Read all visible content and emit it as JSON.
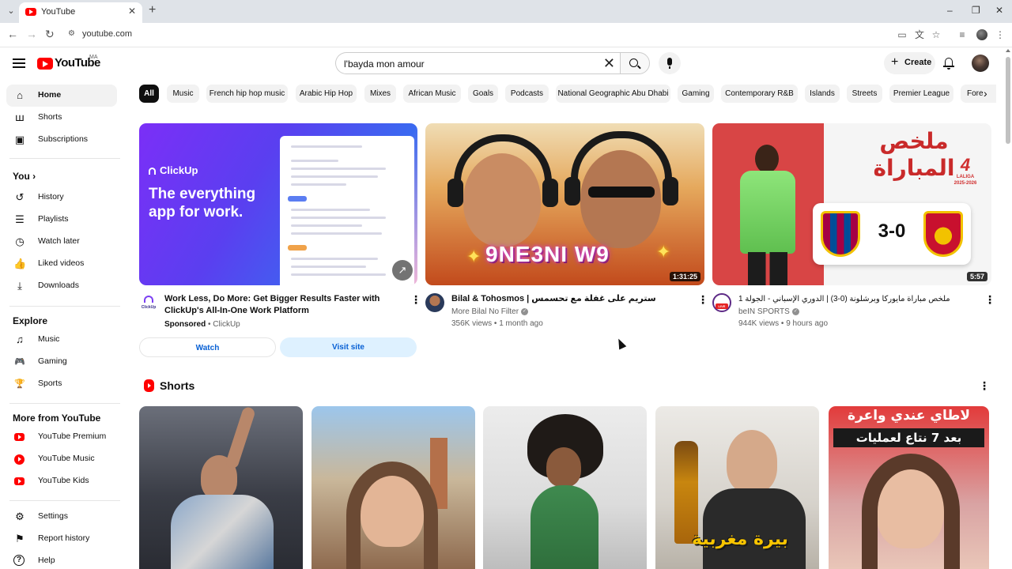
{
  "browser": {
    "tab_title": "YouTube",
    "url": "youtube.com",
    "new_tab": "+",
    "close": "✕"
  },
  "masthead": {
    "logo_text": "YouTube",
    "country_code": "MA",
    "search_value": "l'bayda mon amour",
    "create_label": "Create"
  },
  "sidebar": {
    "main": [
      {
        "label": "Home",
        "icon": "home-icon",
        "glyph": "⌂"
      },
      {
        "label": "Shorts",
        "icon": "shorts-icon",
        "glyph": "ꟺ"
      },
      {
        "label": "Subscriptions",
        "icon": "subscriptions-icon",
        "glyph": "▣"
      }
    ],
    "you_heading": "You",
    "you": [
      {
        "label": "History",
        "icon": "history-icon",
        "glyph": "↺"
      },
      {
        "label": "Playlists",
        "icon": "playlists-icon",
        "glyph": "☰"
      },
      {
        "label": "Watch later",
        "icon": "clock-icon",
        "glyph": "◷"
      },
      {
        "label": "Liked videos",
        "icon": "thumbs-up-icon",
        "glyph": "👍"
      },
      {
        "label": "Downloads",
        "icon": "download-icon",
        "glyph": "⤓"
      }
    ],
    "explore_heading": "Explore",
    "explore": [
      {
        "label": "Music",
        "icon": "music-icon",
        "glyph": "♫"
      },
      {
        "label": "Gaming",
        "icon": "gaming-icon",
        "glyph": "🎮"
      },
      {
        "label": "Sports",
        "icon": "trophy-icon",
        "glyph": "🏆"
      }
    ],
    "more_heading": "More from YouTube",
    "more": [
      {
        "label": "YouTube Premium",
        "icon": "youtube-premium-icon"
      },
      {
        "label": "YouTube Music",
        "icon": "youtube-music-icon"
      },
      {
        "label": "YouTube Kids",
        "icon": "youtube-kids-icon"
      }
    ],
    "footer": [
      {
        "label": "Settings",
        "icon": "settings-icon",
        "glyph": "⚙"
      },
      {
        "label": "Report history",
        "icon": "flag-icon",
        "glyph": "⚑"
      },
      {
        "label": "Help",
        "icon": "help-icon",
        "glyph": "?"
      }
    ]
  },
  "chips": [
    "All",
    "Music",
    "French hip hop music",
    "Arabic Hip Hop",
    "Mixes",
    "African Music",
    "Goals",
    "Podcasts",
    "National Geographic Abu Dhabi",
    "Gaming",
    "Contemporary R&B",
    "Islands",
    "Streets",
    "Premier League",
    "Fore"
  ],
  "ad": {
    "thumb_brand": "ClickUp",
    "thumb_headline": "The everything app for work.",
    "title": "Work Less, Do More: Get Bigger Results Faster with ClickUp's All-In-One Work Platform",
    "sponsored": "Sponsored",
    "advertiser": "ClickUp",
    "logo_text": "ClickUp",
    "watch_label": "Watch",
    "visit_label": "Visit site"
  },
  "videos": [
    {
      "title": "Bilal & Tohosmos | ستريم على غفلة مع تحسمس",
      "channel": "More Bilal No Filter",
      "meta": "356K views • 1 month ago",
      "duration": "1:31:25",
      "thumb_text": "9NE3NI W9"
    },
    {
      "title": "ملخص مباراة مايوركا وبرشلونة (0-3) | الدوري الإسباني - الجولة 1",
      "channel": "beIN SPORTS",
      "meta": "944K views • 9 hours ago",
      "duration": "5:57",
      "thumb_text": "ملخص المباراة",
      "league": "LALIGA",
      "season": "2025-2026",
      "score": "3-0"
    }
  ],
  "shorts": {
    "heading": "Shorts",
    "s4_text": "بيرة مغربية",
    "s5_line1": "لاطاي عندي واعرة",
    "s5_line2": "بعد 7 نتاع لعمليات"
  },
  "colors": {
    "brand_red": "#ff0000",
    "link_blue": "#065fd4",
    "chip_active": "#0f0f0f"
  }
}
